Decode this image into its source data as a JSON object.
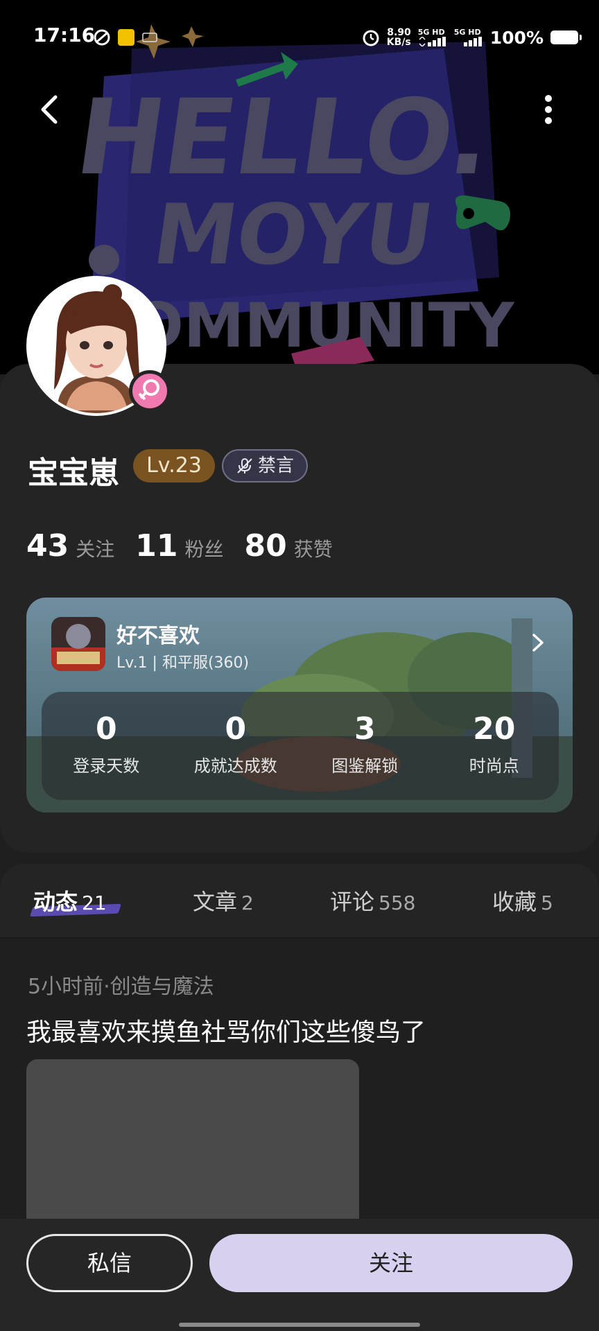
{
  "status_bar": {
    "time": "17:16",
    "net_speed_value": "8.90",
    "net_speed_unit": "KB/s",
    "sig1": "5G HD",
    "sig2": "5G HD",
    "battery": "100%"
  },
  "banner": {
    "line1": "HELLO.",
    "line2": "MOYU",
    "line3": "OMMUNITY"
  },
  "profile": {
    "username": "宝宝崽",
    "level": "Lv.23",
    "mute_label": "禁言",
    "stats": [
      {
        "num": "43",
        "label": "关注"
      },
      {
        "num": "11",
        "label": "粉丝"
      },
      {
        "num": "80",
        "label": "获赞"
      }
    ]
  },
  "game_card": {
    "title": "好不喜欢",
    "subtitle": "Lv.1 | 和平服(360)",
    "stats": [
      {
        "num": "0",
        "label": "登录天数"
      },
      {
        "num": "0",
        "label": "成就达成数"
      },
      {
        "num": "3",
        "label": "图鉴解锁"
      },
      {
        "num": "20",
        "label": "时尚点"
      }
    ]
  },
  "tabs": [
    {
      "label": "动态",
      "count": "21"
    },
    {
      "label": "文章",
      "count": "2"
    },
    {
      "label": "评论",
      "count": "558"
    },
    {
      "label": "收藏",
      "count": "5"
    }
  ],
  "post": {
    "meta": "5小时前·创造与魔法",
    "text": "我最喜欢来摸鱼社骂你们这些傻鸟了"
  },
  "actions": {
    "message": "私信",
    "follow": "关注"
  },
  "colors": {
    "accent": "#5a4bb0",
    "level_bg": "#7a5320",
    "follow_bg": "#d7d1ef",
    "gender": "#f07ab0"
  }
}
